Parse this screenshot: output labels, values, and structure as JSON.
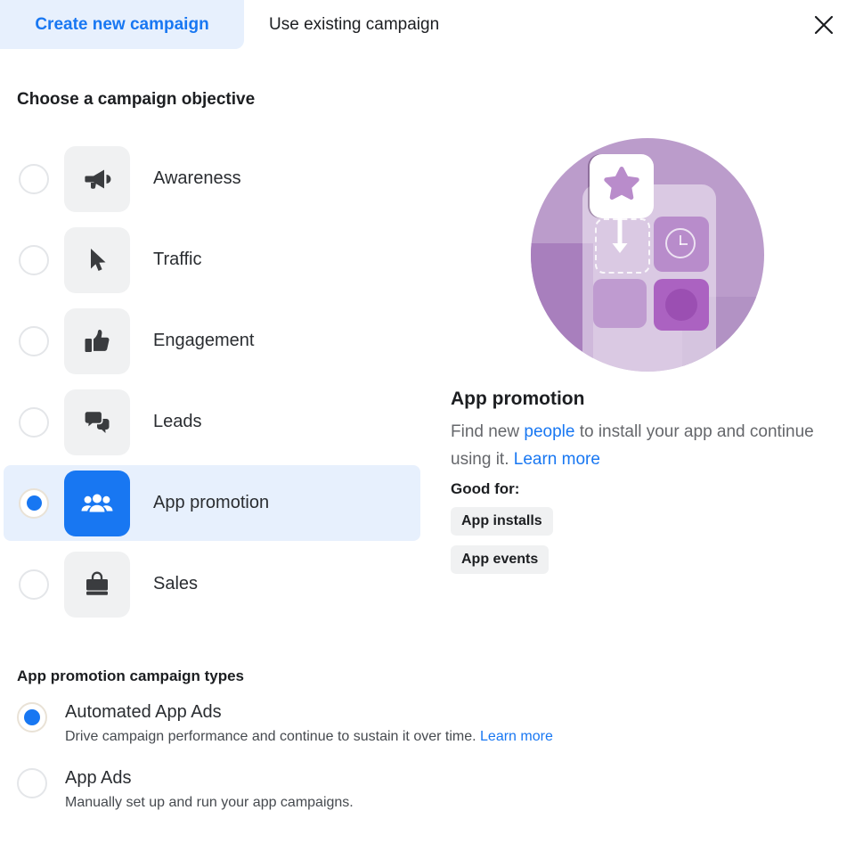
{
  "tabs": [
    {
      "label": "Create new campaign",
      "active": true
    },
    {
      "label": "Use existing campaign",
      "active": false
    }
  ],
  "close_icon": "close-icon",
  "objective_section": {
    "heading": "Choose a campaign objective",
    "options": [
      {
        "label": "Awareness",
        "icon": "megaphone-icon",
        "selected": false
      },
      {
        "label": "Traffic",
        "icon": "cursor-icon",
        "selected": false
      },
      {
        "label": "Engagement",
        "icon": "thumbs-up-icon",
        "selected": false
      },
      {
        "label": "Leads",
        "icon": "chat-bubbles-icon",
        "selected": false
      },
      {
        "label": "App promotion",
        "icon": "people-group-icon",
        "selected": true
      },
      {
        "label": "Sales",
        "icon": "shopping-bag-icon",
        "selected": false
      }
    ]
  },
  "detail": {
    "illustration": "app-promotion-illustration",
    "title": "App promotion",
    "description_part1": "Find new ",
    "description_link1": "people",
    "description_part2": " to install your app and continue using it. ",
    "description_link2": "Learn more",
    "good_for_label": "Good for:",
    "tags": [
      "App installs",
      "App events"
    ]
  },
  "campaign_types": {
    "heading": "App promotion campaign types",
    "options": [
      {
        "name": "Automated App Ads",
        "description": "Drive campaign performance and continue to sustain it over time. ",
        "link": "Learn more",
        "selected": true
      },
      {
        "name": "App Ads",
        "description": "Manually set up and run your app campaigns.",
        "link": "",
        "selected": false
      }
    ]
  },
  "colors": {
    "accent": "#1877f2",
    "tab_active_bg": "#e7f0fd",
    "tile_bg": "#f0f1f2",
    "row_selected_bg": "#e7f0fd",
    "text_primary": "#1c1e21",
    "text_secondary": "#65676b",
    "illustration_bg": "#bb9ccb"
  }
}
